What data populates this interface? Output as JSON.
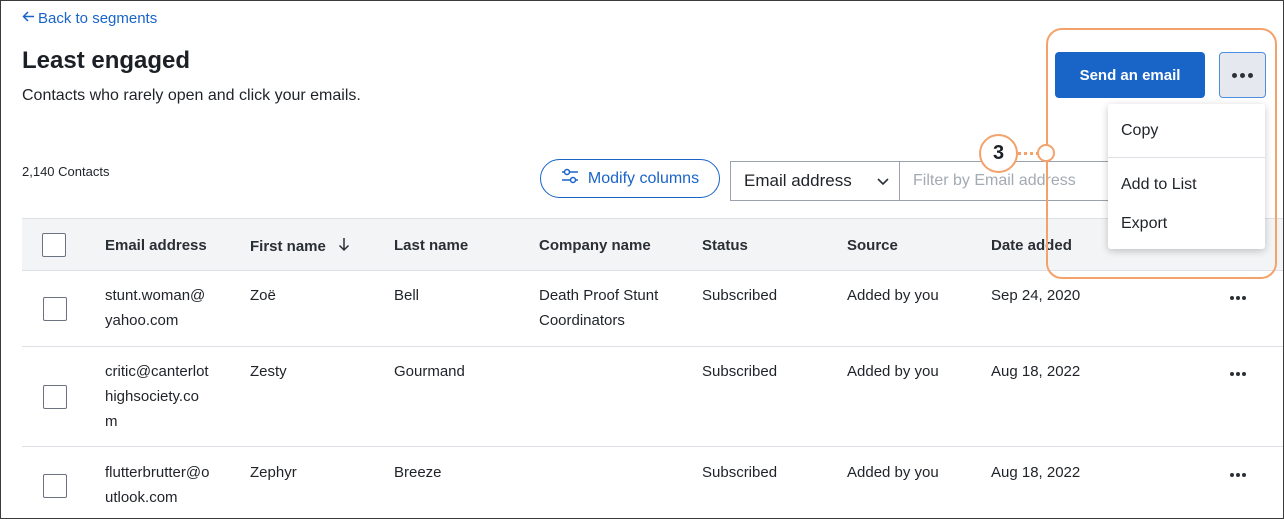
{
  "nav": {
    "back_label": "Back to segments"
  },
  "header": {
    "title": "Least engaged",
    "subtitle": "Contacts who rarely open and click your emails."
  },
  "actions": {
    "send_label": "Send an email",
    "more_icon": "ellipsis-icon",
    "menu": [
      "Copy",
      "Add to List",
      "Export"
    ]
  },
  "toolbar": {
    "contacts_count": "2,140 Contacts",
    "modify_columns_label": "Modify columns",
    "filter_field": "Email address",
    "filter_placeholder": "Filter by Email address"
  },
  "table": {
    "columns": [
      "Email address",
      "First name",
      "Last name",
      "Company name",
      "Status",
      "Source",
      "Date added"
    ],
    "sorted_column": "First name",
    "rows": [
      {
        "email": [
          "stunt.woman@",
          "yahoo.com"
        ],
        "first": "Zoë",
        "last": "Bell",
        "company": [
          "Death Proof Stunt",
          "Coordinators"
        ],
        "status": "Subscribed",
        "source": "Added by you",
        "date": "Sep 24, 2020"
      },
      {
        "email": [
          "critic@canterlot",
          "highsociety.co",
          "m"
        ],
        "first": "Zesty",
        "last": "Gourmand",
        "company": [
          "",
          ""
        ],
        "status": "Subscribed",
        "source": "Added by you",
        "date": "Aug 18, 2022"
      },
      {
        "email": [
          "flutterbrutter@o",
          "utlook.com"
        ],
        "first": "Zephyr",
        "last": "Breeze",
        "company": [
          "",
          ""
        ],
        "status": "Subscribed",
        "source": "Added by you",
        "date": "Aug 18, 2022"
      }
    ]
  },
  "callout": {
    "number": "3"
  },
  "colors": {
    "primary": "#1865c7",
    "callout": "#f4a26b",
    "header_bg": "#f2f4f6"
  }
}
